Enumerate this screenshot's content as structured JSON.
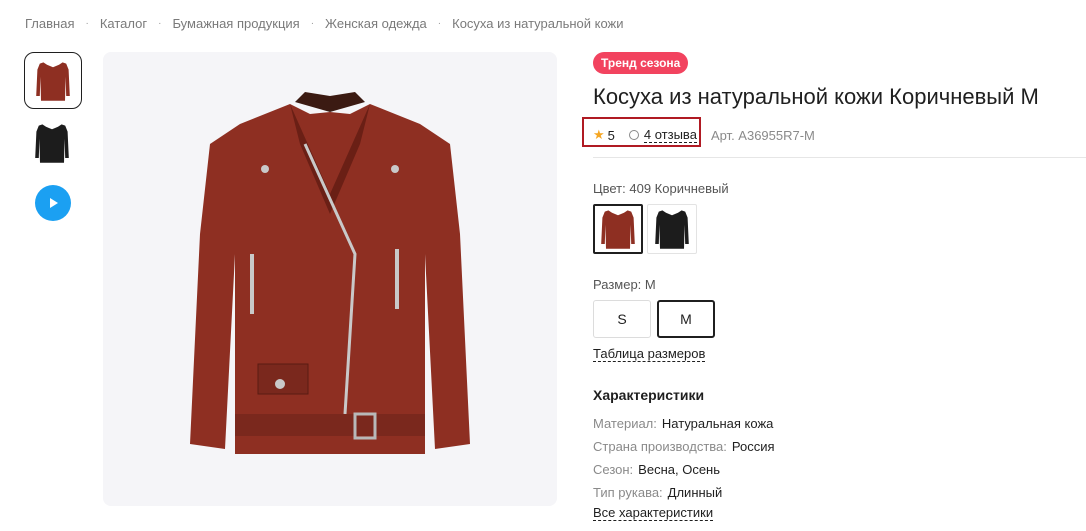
{
  "breadcrumb": [
    "Главная",
    "Каталог",
    "Бумажная продукция",
    "Женская одежда",
    "Косуха из натуральной кожи"
  ],
  "product": {
    "badge": "Тренд сезона",
    "title": "Косуха из натуральной кожи Коричневый M",
    "rating": "5",
    "reviews": "4 отзыва",
    "article": "Арт. A36955R7-M"
  },
  "color": {
    "label": "Цвет: 409 Коричневый",
    "options": [
      "brown",
      "black"
    ],
    "selected": "brown"
  },
  "size": {
    "label": "Размер: M",
    "options": [
      "S",
      "M"
    ],
    "selected": "M",
    "table_link": "Таблица размеров"
  },
  "characteristics": {
    "title": "Характеристики",
    "rows": [
      {
        "key": "Материал:",
        "value": "Натуральная кожа"
      },
      {
        "key": "Страна производства:",
        "value": "Россия"
      },
      {
        "key": "Сезон:",
        "value": "Весна, Осень"
      },
      {
        "key": "Тип рукава:",
        "value": "Длинный"
      }
    ],
    "all_link": "Все характеристики"
  },
  "colors": {
    "badge": "#f2435f",
    "accent": "#1ba0f2",
    "highlight": "#b01a23",
    "jacket_brown": "#8e2f22",
    "jacket_black": "#1c1c1c"
  }
}
